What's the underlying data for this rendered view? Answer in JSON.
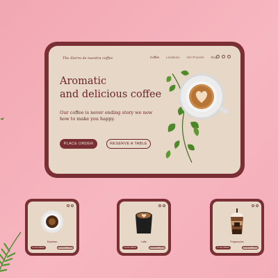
{
  "brand": {
    "logo": "The Sierra de nuestra coffee"
  },
  "nav": {
    "links": [
      "Coffee",
      "Locations",
      "Our Process",
      "Blog"
    ],
    "icons": [
      "search-icon",
      "user-icon",
      "cart-icon"
    ]
  },
  "hero": {
    "headline_line1": "Aromatic",
    "headline_line2": "and delicious coffee",
    "subtext_line1": "Our coffee is never ending story we now",
    "subtext_line2": "how to make you happy.",
    "primary_button": "PLACE ORDER",
    "secondary_button": "RESERVE A TABLE"
  },
  "cards": [
    {
      "title": "Espresso",
      "order_label": "PLACE ORDER",
      "reserve_label": "RESERVE A TABLE"
    },
    {
      "title": "Latte",
      "order_label": "PLACE ORDER",
      "reserve_label": "RESERVE A TABLE"
    },
    {
      "title": "Frappuccino",
      "order_label": "PLACE ORDER",
      "reserve_label": "RESERVE A TABLE"
    }
  ],
  "colors": {
    "background": "#f4adb8",
    "frame": "#7a2f35",
    "panel": "#e6d7c6",
    "text": "#6a2428",
    "leaf": "#4e8a2a"
  }
}
